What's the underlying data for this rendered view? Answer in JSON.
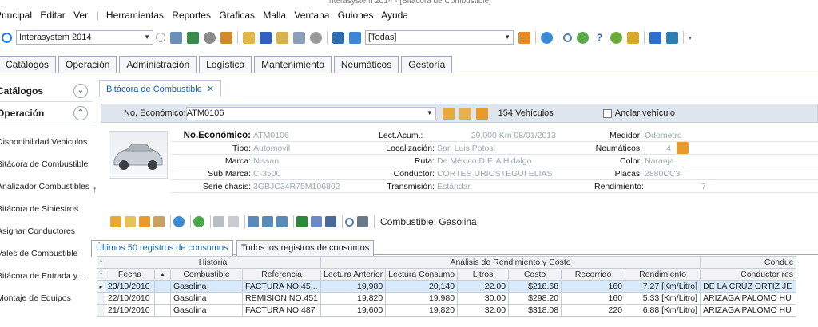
{
  "window": {
    "title": "Interasystem 2014 - [Bitácora de Combustible]"
  },
  "menu": [
    "Principal",
    "Editar",
    "Ver",
    "Herramientas",
    "Reportes",
    "Graficas",
    "Malla",
    "Ventana",
    "Guiones",
    "Ayuda"
  ],
  "toolbar": {
    "company": "Interasystem 2014",
    "filter": "[Todas]"
  },
  "tabs": [
    "Catálogos",
    "Operación",
    "Administración",
    "Logística",
    "Mantenimiento",
    "Neumáticos",
    "Gestoría"
  ],
  "sidebar": {
    "catalogos": "Catálogos",
    "operacion": "Operación",
    "items": [
      "Disponibilidad Vehiculos",
      "Bitácora de Combustible",
      "Analizador Combustibles",
      "Bitácora de Siniestros",
      "Asignar Conductores",
      "Vales de Combustible",
      "Bitácora de Entrada y ...",
      "Montaje de Equipos"
    ]
  },
  "doc": {
    "tab": "Bitácora de Combustible"
  },
  "vehicle_bar": {
    "label": "No. Económico:",
    "value": "ATM0106",
    "count": "154 Vehículos",
    "anchor": "Anclar vehículo"
  },
  "info": {
    "no_eco_label": "No.Económico:",
    "no_eco": "ATM0106",
    "tipo_label": "Tipo:",
    "tipo": "Automovil",
    "marca_label": "Marca:",
    "marca": "Nissan",
    "submarca_label": "Sub Marca:",
    "submarca": "C-3500",
    "serie_label": "Serie chasis:",
    "serie": "3GBJC34R75M106802",
    "lect_label": "Lect.Acum.:",
    "lect": "29,000  Km  08/01/2013",
    "loc_label": "Localización:",
    "loc": "San Luis Potosi",
    "ruta_label": "Ruta:",
    "ruta": "De México D.F. A Hidalgo",
    "cond_label": "Conductor:",
    "cond": "CORTES URIOSTEGUI ELIAS",
    "trans_label": "Transmisión:",
    "trans": "Estándar",
    "medidor_label": "Medidor:",
    "medidor": "Odometro",
    "neum_label": "Neumáticos:",
    "neum": "4",
    "color_label": "Color:",
    "color": "Naranja",
    "placas_label": "Placas:",
    "placas": "2880CC3",
    "rend_label": "Rendimiento:",
    "rend": "7"
  },
  "actions": {
    "fuel": "Combustible: Gasolina"
  },
  "subtabs": [
    "Últimos 50 registros de consumos",
    "Todos los registros de consumos"
  ],
  "grid": {
    "group_historia": "Historia",
    "group_analisis": "Análisis de Rendimiento y Costo",
    "group_cond": "Conduc",
    "columns": [
      "Fecha",
      "Combustible",
      "Referencia",
      "Lectura Anterior",
      "Lectura Consumo",
      "Litros",
      "Costo",
      "Recorrido",
      "Rendimiento",
      "Conductor res"
    ],
    "rows": [
      [
        "23/10/2010",
        "Gasolina",
        "FACTURA NO.45...",
        "19,980",
        "20,140",
        "22.00",
        "$218.68",
        "160",
        "7.27 [Km/Litro]",
        "DE LA CRUZ ORTIZ JE"
      ],
      [
        "22/10/2010",
        "Gasolina",
        "REMISIÓN NO.451",
        "19,820",
        "19,980",
        "30.00",
        "$298.20",
        "160",
        "5.33 [Km/Litro]",
        "ARIZAGA PALOMO HU"
      ],
      [
        "21/10/2010",
        "Gasolina",
        "FACTURA NO.487",
        "19,600",
        "19,820",
        "32.00",
        "$318.08",
        "220",
        "6.88 [Km/Litro]",
        "ARIZAGA PALOMO HU"
      ]
    ]
  }
}
